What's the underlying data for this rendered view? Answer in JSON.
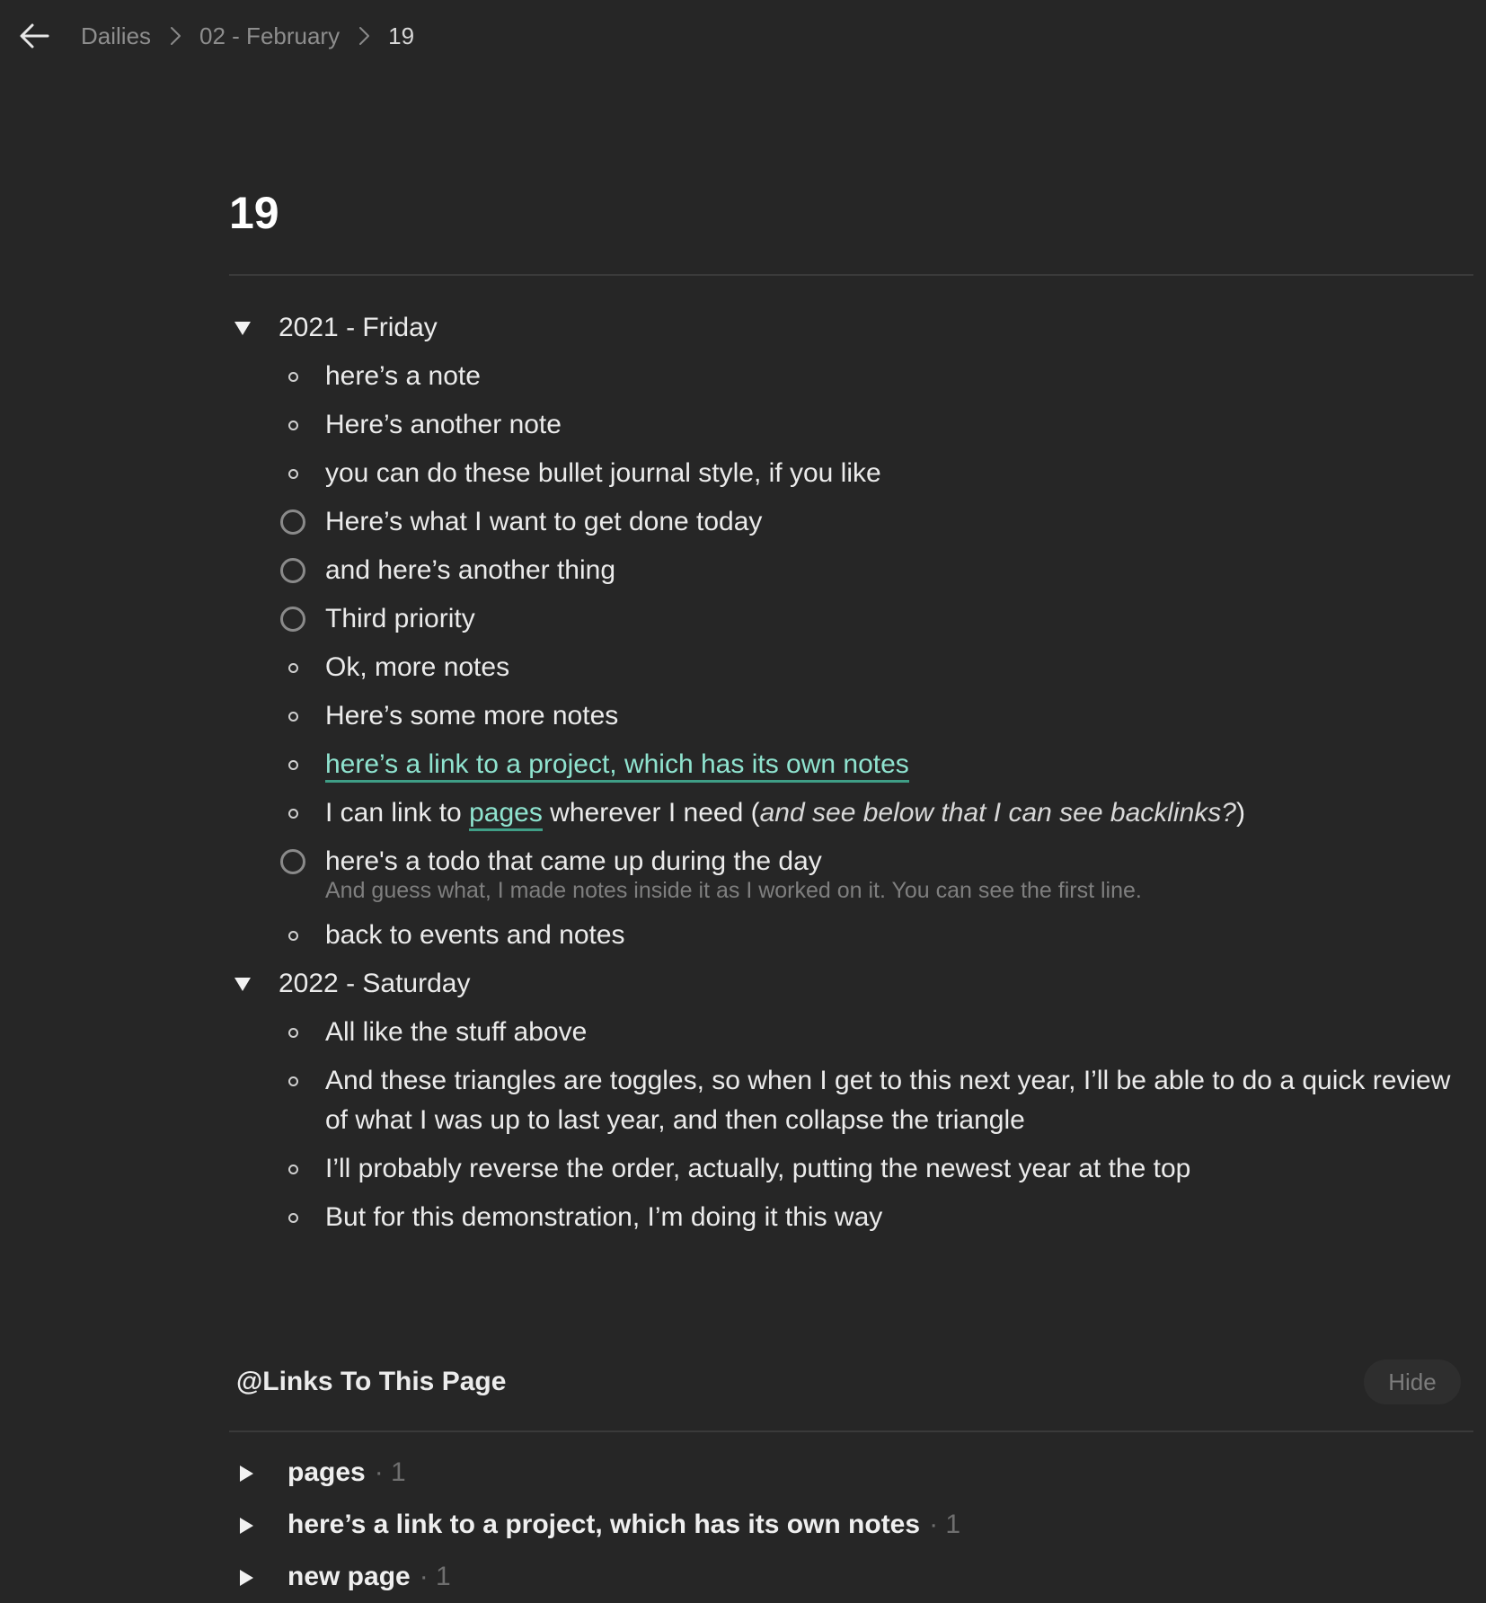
{
  "breadcrumb": {
    "items": [
      "Dailies",
      "02 - February",
      "19"
    ]
  },
  "page": {
    "title": "19"
  },
  "outline": {
    "sections": [
      {
        "label": "2021 - Friday",
        "items": [
          {
            "type": "bullet",
            "text": "here’s a note"
          },
          {
            "type": "bullet",
            "text": "Here’s another note"
          },
          {
            "type": "bullet",
            "text": "you can do these bullet journal style, if you like"
          },
          {
            "type": "todo",
            "text": "Here’s what I want to get done today"
          },
          {
            "type": "todo",
            "text": "and here’s another thing"
          },
          {
            "type": "todo",
            "text": "Third priority"
          },
          {
            "type": "bullet",
            "text": "Ok, more notes"
          },
          {
            "type": "bullet",
            "text": "Here’s some more notes"
          },
          {
            "type": "bullet-link",
            "text": "here’s a link to a project, which has its own notes"
          },
          {
            "type": "bullet-mixed",
            "before": "I can link to ",
            "link": "pages",
            "after": " wherever I need (",
            "italic": "and see below that I can see backlinks?",
            "close": ")"
          },
          {
            "type": "todo-note",
            "text": "here's a todo that came up during the day",
            "note": "And guess what, I made notes inside it as I worked on it. You can see the first line."
          },
          {
            "type": "bullet",
            "text": "back to events and notes"
          }
        ]
      },
      {
        "label": "2022 - Saturday",
        "items": [
          {
            "type": "bullet",
            "text": "All like the stuff above"
          },
          {
            "type": "bullet",
            "text": "And these triangles are toggles, so when I get to this next year, I’ll be able to do a quick review of what I was up to last year, and then collapse the triangle"
          },
          {
            "type": "bullet",
            "text": "I’ll probably reverse the order, actually, putting the newest year at the top"
          },
          {
            "type": "bullet",
            "text": "But for this demonstration, I’m doing it this way"
          }
        ]
      }
    ]
  },
  "backlinks": {
    "title": "@Links To This Page",
    "hide_label": "Hide",
    "items": [
      {
        "label": "pages",
        "count": "· 1"
      },
      {
        "label": "here’s a link to a project, which has its own notes",
        "count": "· 1"
      },
      {
        "label": "new page",
        "count": "· 1"
      }
    ]
  },
  "colors": {
    "background": "#262626",
    "link": "#8fe3cf",
    "link_underline": "#3f9e86",
    "muted": "#7f7f7f"
  },
  "icons": {
    "back": "arrow-left-icon",
    "separator": "chevron-right-icon",
    "section_toggle": "triangle-down-icon",
    "backlink_toggle": "triangle-right-icon",
    "bullet": "bullet-dot-icon",
    "todo": "circle-checkbox-icon"
  }
}
